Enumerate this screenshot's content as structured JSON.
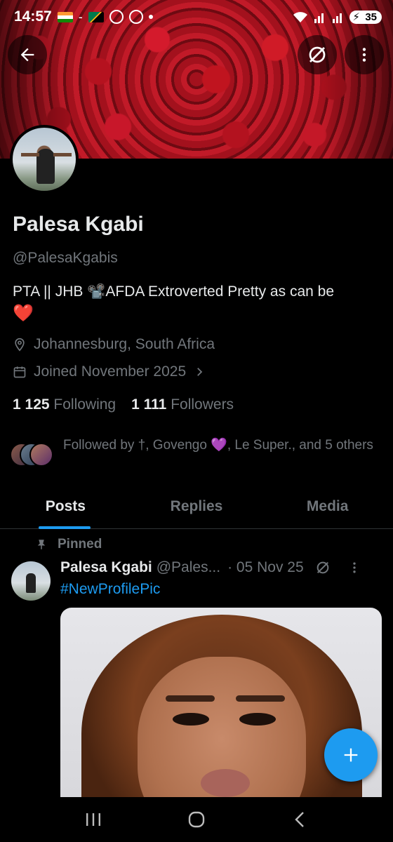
{
  "status_bar": {
    "time": "14:57",
    "separator": "-",
    "battery": "35",
    "icons": [
      "flag-india-icon",
      "flag-south-africa-icon",
      "whatsapp-icon",
      "tesco-icon",
      "notification-dot",
      "wifi-icon",
      "signal-icon",
      "signal-icon-2",
      "battery-icon"
    ]
  },
  "header": {
    "back_icon": "arrow-left-icon",
    "grok_icon": "grok-icon",
    "more_icon": "more-vertical-icon"
  },
  "profile": {
    "name": "Palesa Kgabi",
    "handle": "@PalesaKgabis",
    "bio": "PTA || JHB 📽️AFDA Extroverted Pretty as can be",
    "bio_emoji": "❤️",
    "location": "Johannesburg, South Africa",
    "joined": "Joined November 2025",
    "following_count": "1 125",
    "following_label": "Following",
    "followers_count": "1 111",
    "followers_label": "Followers",
    "followed_by": "Followed by †, Govengo 💜, Le Super., and 5 others"
  },
  "tabs": [
    {
      "label": "Posts",
      "active": true
    },
    {
      "label": "Replies",
      "active": false
    },
    {
      "label": "Media",
      "active": false
    }
  ],
  "post": {
    "pinned_label": "Pinned",
    "author_name": "Palesa Kgabi",
    "author_handle": "@Pales...",
    "date": "· 05 Nov 25",
    "text": "#NewProfilePic"
  },
  "colors": {
    "accent": "#1d9bf0",
    "background": "#000000",
    "muted_text": "#71767b",
    "primary_text": "#e7e9ea"
  }
}
